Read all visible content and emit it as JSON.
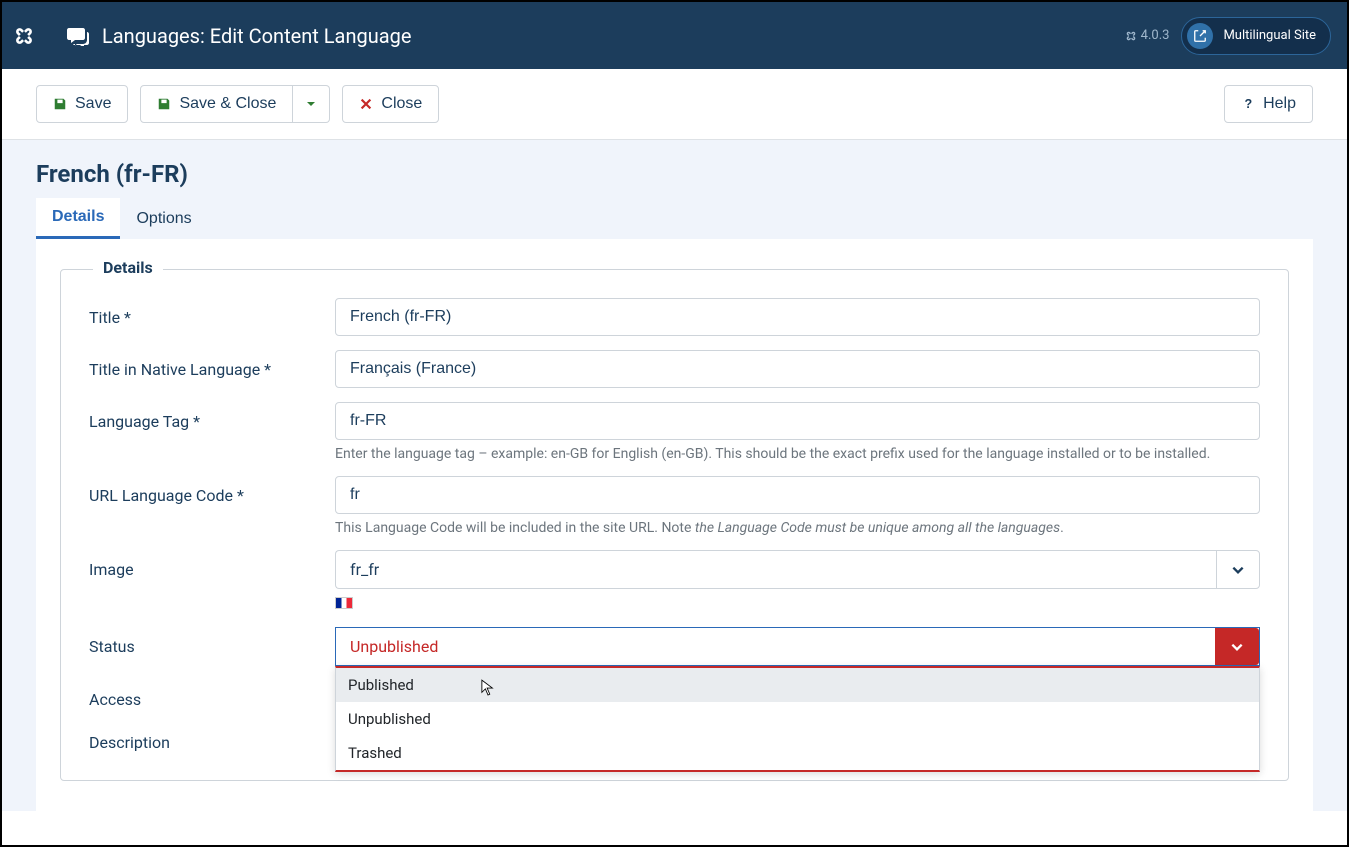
{
  "header": {
    "title": "Languages: Edit Content Language",
    "version": "4.0.3",
    "site_link": "Multilingual Site"
  },
  "toolbar": {
    "save": "Save",
    "save_close": "Save & Close",
    "close": "Close",
    "help": "Help"
  },
  "page": {
    "title": "French (fr-FR)"
  },
  "tabs": [
    {
      "label": "Details",
      "active": true
    },
    {
      "label": "Options",
      "active": false
    }
  ],
  "fieldset": {
    "legend": "Details"
  },
  "form": {
    "title": {
      "label": "Title *",
      "value": "French (fr-FR)"
    },
    "native": {
      "label": "Title in Native Language *",
      "value": "Français (France)"
    },
    "tag": {
      "label": "Language Tag *",
      "value": "fr-FR",
      "help": "Enter the language tag – example: en-GB for English (en-GB). This should be the exact prefix used for the language installed or to be installed."
    },
    "url_code": {
      "label": "URL Language Code *",
      "value": "fr",
      "help_prefix": "This Language Code will be included in the site URL. Note ",
      "help_em": "the Language Code must be unique among all the languages",
      "help_suffix": "."
    },
    "image": {
      "label": "Image",
      "value": "fr_fr"
    },
    "status": {
      "label": "Status",
      "value": "Unpublished",
      "options": [
        "Published",
        "Unpublished",
        "Trashed"
      ]
    },
    "access": {
      "label": "Access"
    },
    "description": {
      "label": "Description"
    }
  }
}
